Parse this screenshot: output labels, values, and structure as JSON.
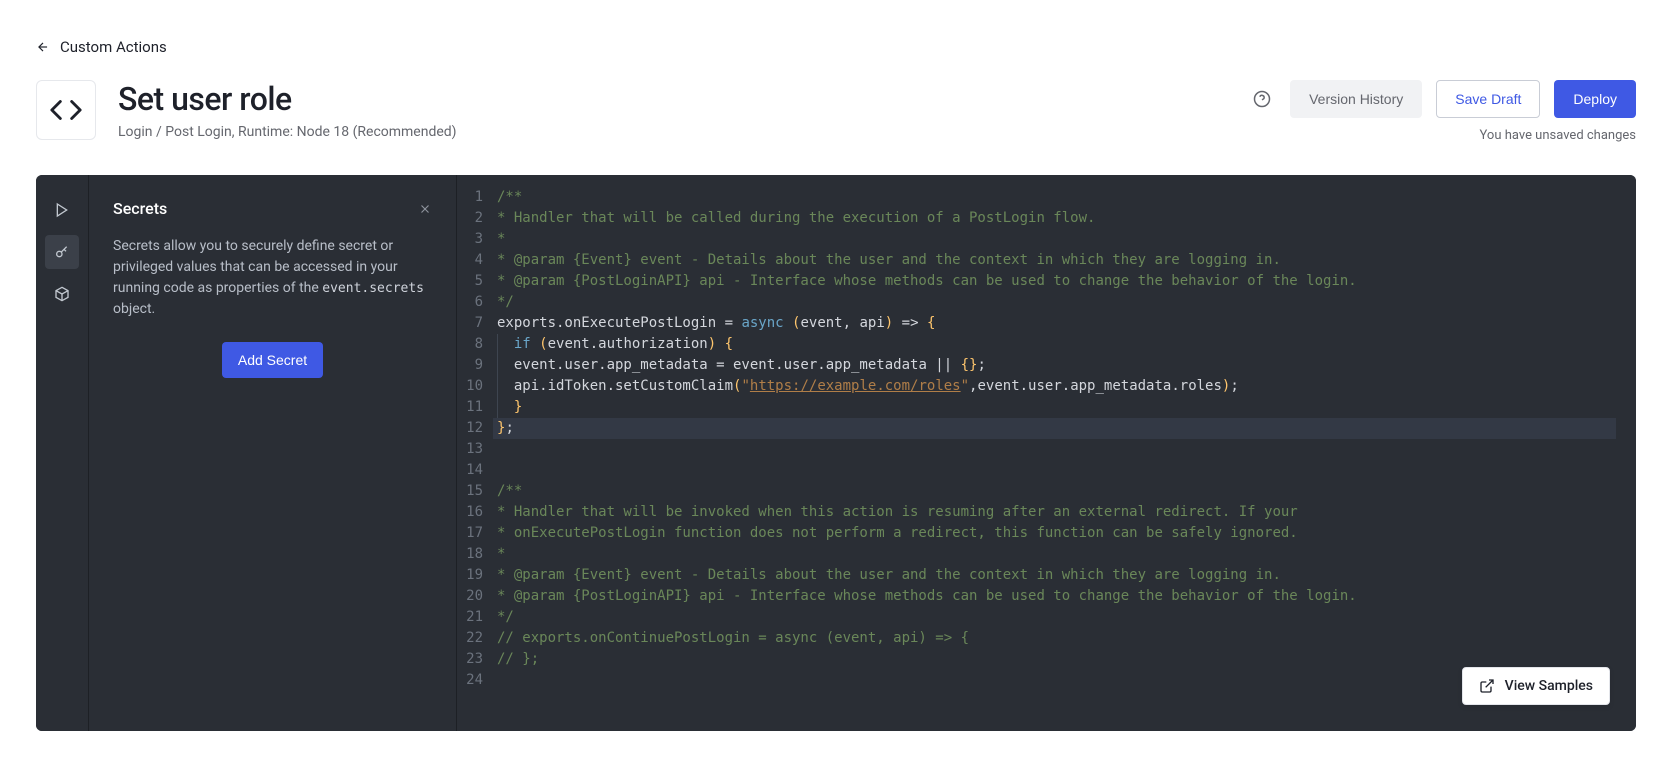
{
  "breadcrumb": {
    "label": "Custom Actions"
  },
  "page": {
    "title": "Set user role",
    "subtitle": "Login / Post Login, Runtime: Node 18 (Recommended)"
  },
  "header": {
    "version_history": "Version History",
    "save_draft": "Save Draft",
    "deploy": "Deploy",
    "unsaved": "You have unsaved changes"
  },
  "panel": {
    "title": "Secrets",
    "desc_prefix": "Secrets allow you to securely define secret or privileged values that can be accessed in your running code as properties of the ",
    "desc_code": "event.secrets",
    "desc_suffix": " object.",
    "add_secret": "Add Secret"
  },
  "view_samples": "View Samples",
  "code": {
    "highlight_line": 12,
    "lines": [
      {
        "n": 1,
        "cls": "",
        "html": "<span class='c-comment'>/**</span>"
      },
      {
        "n": 2,
        "cls": "",
        "html": "<span class='c-comment'>* Handler that will be called during the execution of a PostLogin flow.</span>"
      },
      {
        "n": 3,
        "cls": "",
        "html": "<span class='c-comment'>*</span>"
      },
      {
        "n": 4,
        "cls": "",
        "html": "<span class='c-comment'>* @param {Event} event - Details about the user and the context in which they are logging in.</span>"
      },
      {
        "n": 5,
        "cls": "",
        "html": "<span class='c-comment'>* @param {PostLoginAPI} api - Interface whose methods can be used to change the behavior of the login.</span>"
      },
      {
        "n": 6,
        "cls": "",
        "html": "<span class='c-comment'>*/</span>"
      },
      {
        "n": 7,
        "cls": "",
        "html": "<span class='c-fn'>exports.onExecutePostLogin = </span><span class='c-kw'>async</span> <span class='c-brace'>(</span><span class='c-fn'>event, api</span><span class='c-brace'>)</span> <span class='c-punc'>=&gt;</span> <span class='c-brace'>{</span>"
      },
      {
        "n": 8,
        "cls": "guide",
        "html": "  <span class='c-kw'>if</span> <span class='c-brace'>(</span><span class='c-fn'>event.authorization</span><span class='c-brace'>)</span> <span class='c-brace'>{</span>"
      },
      {
        "n": 9,
        "cls": "guide",
        "html": "  <span class='c-fn'>event.user.app_metadata = event.user.app_metadata || </span><span class='c-const'>{}</span><span class='c-punc'>;</span>"
      },
      {
        "n": 10,
        "cls": "guide",
        "html": "  <span class='c-fn'>api.idToken.setCustomClaim</span><span class='c-brace'>(</span><span class='c-str'>\"</span><span class='c-link'>https://example.com/roles</span><span class='c-str'>\"</span><span class='c-punc'>,</span><span class='c-fn'>event.user.app_metadata.roles</span><span class='c-brace'>)</span><span class='c-punc'>;</span>"
      },
      {
        "n": 11,
        "cls": "guide",
        "html": "  <span class='c-brace'>}</span>"
      },
      {
        "n": 12,
        "cls": "",
        "html": "<span class='c-brace'>}</span><span class='c-punc'>;</span>"
      },
      {
        "n": 13,
        "cls": "",
        "html": ""
      },
      {
        "n": 14,
        "cls": "",
        "html": ""
      },
      {
        "n": 15,
        "cls": "",
        "html": "<span class='c-comment'>/**</span>"
      },
      {
        "n": 16,
        "cls": "",
        "html": "<span class='c-comment'>* Handler that will be invoked when this action is resuming after an external redirect. If your</span>"
      },
      {
        "n": 17,
        "cls": "",
        "html": "<span class='c-comment'>* onExecutePostLogin function does not perform a redirect, this function can be safely ignored.</span>"
      },
      {
        "n": 18,
        "cls": "",
        "html": "<span class='c-comment'>*</span>"
      },
      {
        "n": 19,
        "cls": "",
        "html": "<span class='c-comment'>* @param {Event} event - Details about the user and the context in which they are logging in.</span>"
      },
      {
        "n": 20,
        "cls": "",
        "html": "<span class='c-comment'>* @param {PostLoginAPI} api - Interface whose methods can be used to change the behavior of the login.</span>"
      },
      {
        "n": 21,
        "cls": "",
        "html": "<span class='c-comment'>*/</span>"
      },
      {
        "n": 22,
        "cls": "",
        "html": "<span class='c-comment'>// exports.onContinuePostLogin = async (event, api) =&gt; {</span>"
      },
      {
        "n": 23,
        "cls": "",
        "html": "<span class='c-comment'>// };</span>"
      },
      {
        "n": 24,
        "cls": "",
        "html": ""
      }
    ]
  }
}
